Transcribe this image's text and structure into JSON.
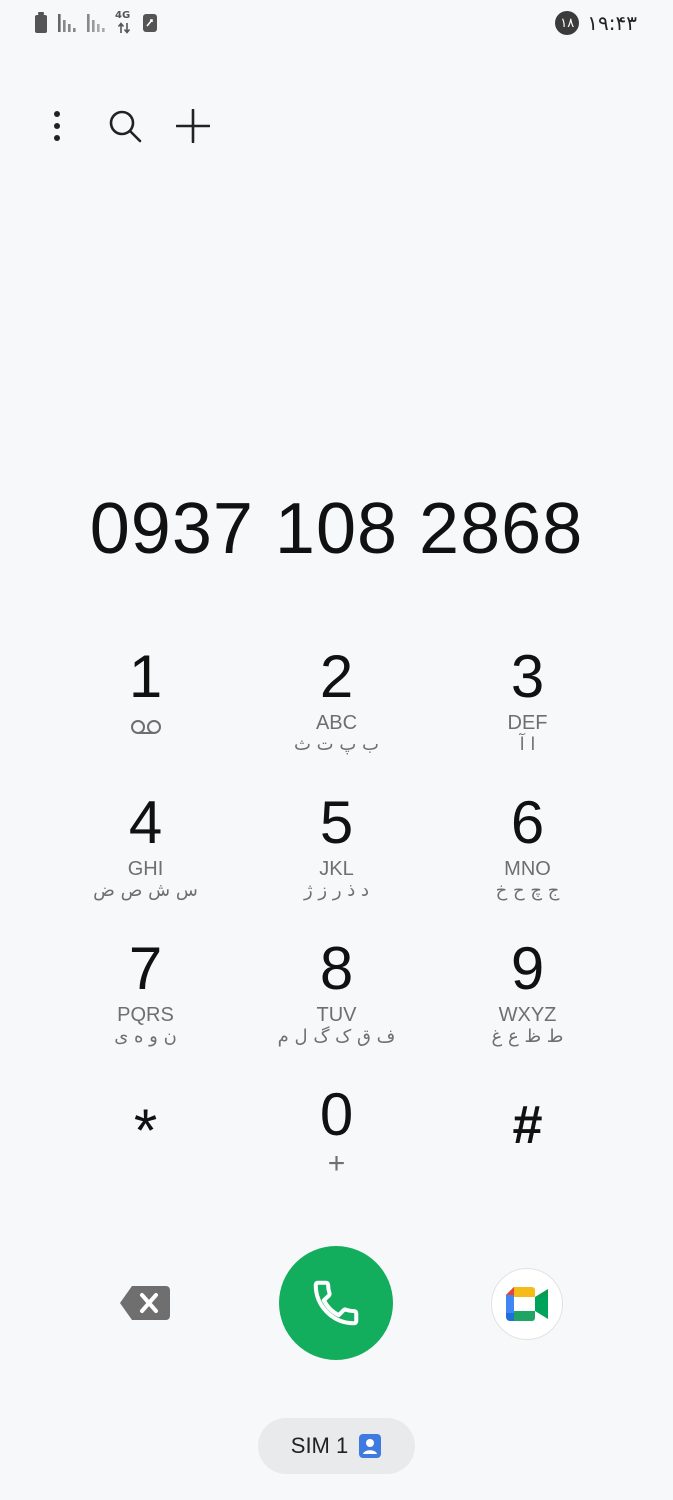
{
  "status_bar": {
    "network_label": "4G",
    "notification_count": "۱۸",
    "time": "۱۹:۴۳"
  },
  "toolbar": {
    "icons": [
      "more-options-icon",
      "search-icon",
      "add-contact-icon"
    ]
  },
  "dialer": {
    "number": "0937 108 2868"
  },
  "keypad": {
    "keys": [
      {
        "digit": "1",
        "letters": "",
        "fa": "",
        "sub_icon": "voicemail-icon"
      },
      {
        "digit": "2",
        "letters": "ABC",
        "fa": "ب پ ت ث"
      },
      {
        "digit": "3",
        "letters": "DEF",
        "fa": "ا آ"
      },
      {
        "digit": "4",
        "letters": "GHI",
        "fa": "س ش ص ض"
      },
      {
        "digit": "5",
        "letters": "JKL",
        "fa": "د ذ ر ز ژ"
      },
      {
        "digit": "6",
        "letters": "MNO",
        "fa": "ج چ ح خ"
      },
      {
        "digit": "7",
        "letters": "PQRS",
        "fa": "ن و ه ی"
      },
      {
        "digit": "8",
        "letters": "TUV",
        "fa": "ف ق ک گ ل م"
      },
      {
        "digit": "9",
        "letters": "WXYZ",
        "fa": "ط ظ ع غ"
      },
      {
        "digit": "*",
        "letters": "",
        "fa": ""
      },
      {
        "digit": "0",
        "letters": "+",
        "fa": ""
      },
      {
        "digit": "#",
        "letters": "",
        "fa": ""
      }
    ]
  },
  "actions": {
    "backspace_icon": "backspace-icon",
    "call_icon": "phone-icon",
    "call_color": "#13ad5e",
    "video_icon": "google-meet-icon"
  },
  "sim": {
    "label": "SIM 1",
    "icon": "sim-contact-icon",
    "icon_color": "#3d7be0"
  }
}
